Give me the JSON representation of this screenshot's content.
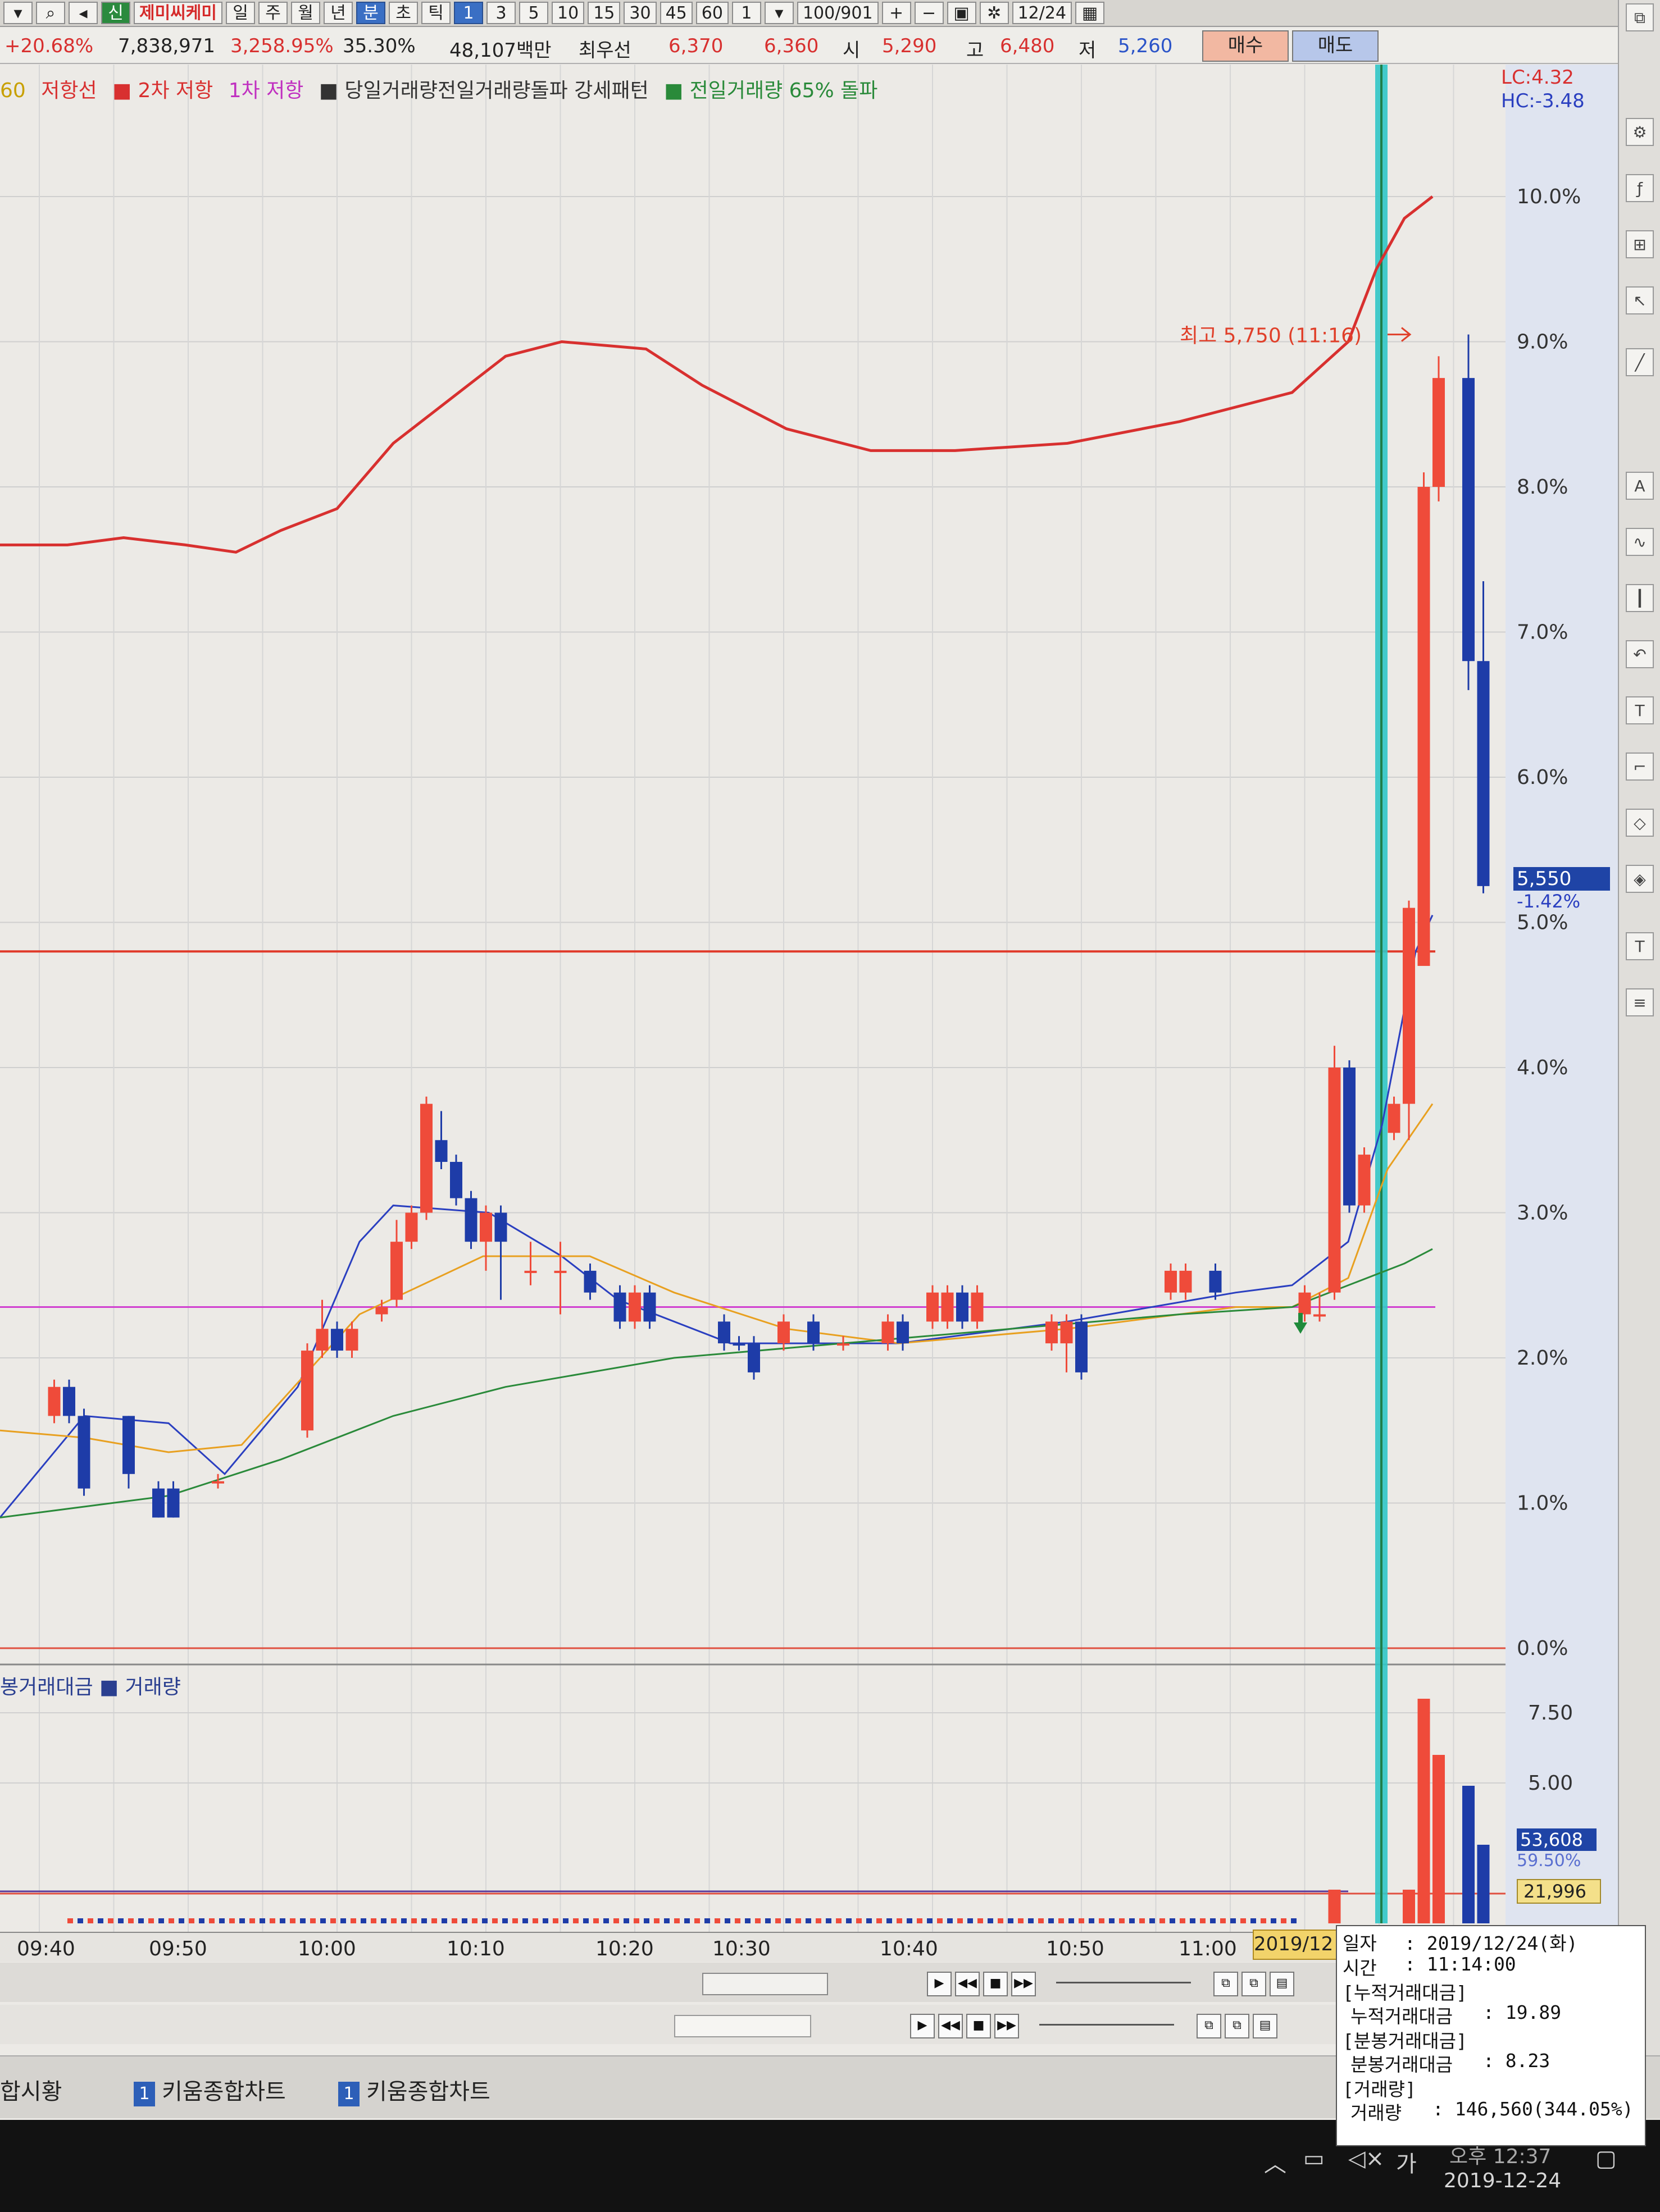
{
  "toolbar": {
    "items": [
      "신",
      "제미씨케미",
      "일",
      "주",
      "월",
      "년",
      "분",
      "초",
      "틱",
      "1",
      "3",
      "5",
      "10",
      "15",
      "30",
      "45",
      "60",
      "1",
      "100/901",
      "12/24"
    ]
  },
  "quote": {
    "change_pct": "+20.68%",
    "volume": "7,838,971",
    "vol_ratio": "3,258.95%",
    "turnover": "35.30%",
    "amount": "48,107백만",
    "best_ask_label": "최우선",
    "ask": "6,370",
    "bid": "6,360",
    "open_label": "시",
    "open": "5,290",
    "high_label": "고",
    "high": "6,480",
    "low_label": "저",
    "low": "5,260",
    "buy_label": "매수",
    "sell_label": "매도"
  },
  "legend": {
    "items": [
      {
        "text": "60",
        "color": "#c8a000"
      },
      {
        "text": "저항선",
        "color": "#d83030"
      },
      {
        "text": "■ 2차 저항",
        "color": "#d83030"
      },
      {
        "text": "1차 저항",
        "color": "#c030c0"
      },
      {
        "text": "■ 당일거래량전일거래량돌파 강세패턴",
        "color": "#333333"
      },
      {
        "text": "■ 전일거래량 65% 돌파",
        "color": "#2a8a3a"
      }
    ]
  },
  "axis_badges": {
    "lc": "LC:4.32",
    "hc": "HC:-3.48",
    "current_price": "5,550",
    "current_pct": "-1.42%",
    "vol_current": "53,608",
    "vol_pct": "59.50%",
    "vol_ma": "21,996"
  },
  "chart_data": {
    "type": "candlestick",
    "title": "제미씨케미 1분",
    "price_axis_ticks": [
      "10.0%",
      "9.0%",
      "8.0%",
      "7.0%",
      "6.0%",
      "5.0%",
      "4.0%",
      "3.0%",
      "2.0%",
      "1.0%",
      "0.0%"
    ],
    "volume_axis_ticks": [
      "7.50",
      "5.00"
    ],
    "time_ticks": [
      "09:40",
      "09:50",
      "10:00",
      "10:10",
      "10:20",
      "10:30",
      "10:40",
      "10:50",
      "11:00",
      "2019/12"
    ],
    "annotation": "최고 5,750 (11:16)",
    "resistance_levels_pct": {
      "horizontal_red": 4.8,
      "magenta": 2.35,
      "zero": 0.0
    },
    "candles": [
      {
        "t": "09:41",
        "o": 1.6,
        "c": 1.8,
        "h": 1.85,
        "l": 1.55,
        "up": true
      },
      {
        "t": "09:42",
        "o": 1.8,
        "c": 1.6,
        "h": 1.85,
        "l": 1.55,
        "up": false
      },
      {
        "t": "09:43",
        "o": 1.6,
        "c": 1.1,
        "h": 1.65,
        "l": 1.05,
        "up": false
      },
      {
        "t": "09:46",
        "o": 1.6,
        "c": 1.2,
        "h": 1.6,
        "l": 1.1,
        "up": false
      },
      {
        "t": "09:48",
        "o": 1.1,
        "c": 0.9,
        "h": 1.15,
        "l": 0.9,
        "up": false
      },
      {
        "t": "09:49",
        "o": 1.1,
        "c": 0.9,
        "h": 1.15,
        "l": 0.9,
        "up": false
      },
      {
        "t": "09:52",
        "o": 1.15,
        "c": 1.15,
        "h": 1.2,
        "l": 1.1,
        "up": true
      },
      {
        "t": "09:58",
        "o": 1.5,
        "c": 2.05,
        "h": 2.1,
        "l": 1.45,
        "up": true
      },
      {
        "t": "09:59",
        "o": 2.05,
        "c": 2.2,
        "h": 2.4,
        "l": 2.0,
        "up": true
      },
      {
        "t": "10:00",
        "o": 2.2,
        "c": 2.05,
        "h": 2.25,
        "l": 2.0,
        "up": false
      },
      {
        "t": "10:01",
        "o": 2.05,
        "c": 2.2,
        "h": 2.25,
        "l": 2.0,
        "up": true
      },
      {
        "t": "10:03",
        "o": 2.3,
        "c": 2.35,
        "h": 2.4,
        "l": 2.25,
        "up": true
      },
      {
        "t": "10:04",
        "o": 2.4,
        "c": 2.8,
        "h": 2.95,
        "l": 2.35,
        "up": true
      },
      {
        "t": "10:05",
        "o": 2.8,
        "c": 3.0,
        "h": 3.05,
        "l": 2.75,
        "up": true
      },
      {
        "t": "10:06",
        "o": 3.0,
        "c": 3.75,
        "h": 3.8,
        "l": 2.95,
        "up": true
      },
      {
        "t": "10:07",
        "o": 3.5,
        "c": 3.35,
        "h": 3.7,
        "l": 3.3,
        "up": false
      },
      {
        "t": "10:08",
        "o": 3.35,
        "c": 3.1,
        "h": 3.4,
        "l": 3.05,
        "up": false
      },
      {
        "t": "10:09",
        "o": 3.1,
        "c": 2.8,
        "h": 3.15,
        "l": 2.75,
        "up": false
      },
      {
        "t": "10:10",
        "o": 2.8,
        "c": 3.0,
        "h": 3.05,
        "l": 2.6,
        "up": true
      },
      {
        "t": "10:11",
        "o": 3.0,
        "c": 2.8,
        "h": 3.05,
        "l": 2.4,
        "up": false
      },
      {
        "t": "10:13",
        "o": 2.6,
        "c": 2.6,
        "h": 2.8,
        "l": 2.5,
        "up": true
      },
      {
        "t": "10:15",
        "o": 2.6,
        "c": 2.6,
        "h": 2.8,
        "l": 2.3,
        "up": true
      },
      {
        "t": "10:17",
        "o": 2.6,
        "c": 2.45,
        "h": 2.65,
        "l": 2.4,
        "up": false
      },
      {
        "t": "10:19",
        "o": 2.45,
        "c": 2.25,
        "h": 2.5,
        "l": 2.2,
        "up": false
      },
      {
        "t": "10:20",
        "o": 2.25,
        "c": 2.45,
        "h": 2.5,
        "l": 2.2,
        "up": true
      },
      {
        "t": "10:21",
        "o": 2.45,
        "c": 2.25,
        "h": 2.5,
        "l": 2.2,
        "up": false
      },
      {
        "t": "10:26",
        "o": 2.25,
        "c": 2.1,
        "h": 2.3,
        "l": 2.05,
        "up": false
      },
      {
        "t": "10:27",
        "o": 2.1,
        "c": 2.1,
        "h": 2.15,
        "l": 2.05,
        "up": false
      },
      {
        "t": "10:28",
        "o": 2.1,
        "c": 1.9,
        "h": 2.15,
        "l": 1.85,
        "up": false
      },
      {
        "t": "10:30",
        "o": 2.1,
        "c": 2.25,
        "h": 2.3,
        "l": 2.05,
        "up": true
      },
      {
        "t": "10:32",
        "o": 2.25,
        "c": 2.1,
        "h": 2.3,
        "l": 2.05,
        "up": false
      },
      {
        "t": "10:34",
        "o": 2.1,
        "c": 2.1,
        "h": 2.15,
        "l": 2.05,
        "up": true
      },
      {
        "t": "10:37",
        "o": 2.1,
        "c": 2.25,
        "h": 2.3,
        "l": 2.05,
        "up": true
      },
      {
        "t": "10:38",
        "o": 2.25,
        "c": 2.1,
        "h": 2.3,
        "l": 2.05,
        "up": false
      },
      {
        "t": "10:40",
        "o": 2.25,
        "c": 2.45,
        "h": 2.5,
        "l": 2.2,
        "up": true
      },
      {
        "t": "10:41",
        "o": 2.25,
        "c": 2.45,
        "h": 2.5,
        "l": 2.2,
        "up": true
      },
      {
        "t": "10:42",
        "o": 2.45,
        "c": 2.25,
        "h": 2.5,
        "l": 2.2,
        "up": false
      },
      {
        "t": "10:43",
        "o": 2.25,
        "c": 2.45,
        "h": 2.5,
        "l": 2.2,
        "up": true
      },
      {
        "t": "10:48",
        "o": 2.1,
        "c": 2.25,
        "h": 2.3,
        "l": 2.05,
        "up": true
      },
      {
        "t": "10:49",
        "o": 2.1,
        "c": 2.25,
        "h": 2.3,
        "l": 1.9,
        "up": true
      },
      {
        "t": "10:50",
        "o": 2.25,
        "c": 1.9,
        "h": 2.3,
        "l": 1.85,
        "up": false
      },
      {
        "t": "10:56",
        "o": 2.45,
        "c": 2.6,
        "h": 2.65,
        "l": 2.4,
        "up": true
      },
      {
        "t": "10:57",
        "o": 2.45,
        "c": 2.6,
        "h": 2.65,
        "l": 2.4,
        "up": true
      },
      {
        "t": "10:59",
        "o": 2.6,
        "c": 2.45,
        "h": 2.65,
        "l": 2.4,
        "up": false
      },
      {
        "t": "11:05",
        "o": 2.3,
        "c": 2.45,
        "h": 2.5,
        "l": 2.25,
        "up": true
      },
      {
        "t": "11:06",
        "o": 2.3,
        "c": 2.3,
        "h": 2.45,
        "l": 2.25,
        "up": true
      },
      {
        "t": "11:07",
        "o": 2.45,
        "c": 4.0,
        "h": 4.15,
        "l": 2.4,
        "up": true
      },
      {
        "t": "11:08",
        "o": 4.0,
        "c": 3.05,
        "h": 4.05,
        "l": 3.0,
        "up": false
      },
      {
        "t": "11:09",
        "o": 3.05,
        "c": 3.4,
        "h": 3.45,
        "l": 3.0,
        "up": true
      },
      {
        "t": "11:11",
        "o": 3.55,
        "c": 3.75,
        "h": 3.8,
        "l": 3.5,
        "up": true
      },
      {
        "t": "11:12",
        "o": 3.75,
        "c": 5.1,
        "h": 5.15,
        "l": 3.5,
        "up": true
      },
      {
        "t": "11:13",
        "o": 4.7,
        "c": 8.0,
        "h": 8.1,
        "l": 4.7,
        "up": true
      },
      {
        "t": "11:14",
        "o": 8.0,
        "c": 8.75,
        "h": 8.9,
        "l": 7.9,
        "up": true
      },
      {
        "t": "11:16",
        "o": 8.75,
        "c": 6.8,
        "h": 9.05,
        "l": 6.6,
        "up": false
      },
      {
        "t": "11:17",
        "o": 6.8,
        "c": 5.25,
        "h": 7.35,
        "l": 5.2,
        "up": false
      }
    ],
    "ma_series": [
      {
        "color": "#2a3fc0",
        "points": [
          [
            0,
            0.9
          ],
          [
            150,
            1.6
          ],
          [
            300,
            1.55
          ],
          [
            400,
            1.2
          ],
          [
            530,
            1.8
          ],
          [
            640,
            2.8
          ],
          [
            700,
            3.05
          ],
          [
            870,
            3.0
          ],
          [
            1000,
            2.7
          ],
          [
            1100,
            2.4
          ],
          [
            1300,
            2.1
          ],
          [
            1600,
            2.1
          ],
          [
            1900,
            2.25
          ],
          [
            2200,
            2.45
          ],
          [
            2300,
            2.5
          ],
          [
            2400,
            2.8
          ],
          [
            2460,
            3.6
          ],
          [
            2520,
            4.8
          ],
          [
            2550,
            5.05
          ]
        ]
      },
      {
        "color": "#e8a020",
        "points": [
          [
            0,
            1.5
          ],
          [
            150,
            1.45
          ],
          [
            300,
            1.35
          ],
          [
            430,
            1.4
          ],
          [
            640,
            2.3
          ],
          [
            860,
            2.7
          ],
          [
            1050,
            2.7
          ],
          [
            1200,
            2.45
          ],
          [
            1400,
            2.2
          ],
          [
            1600,
            2.1
          ],
          [
            1900,
            2.2
          ],
          [
            2200,
            2.35
          ],
          [
            2300,
            2.35
          ],
          [
            2400,
            2.55
          ],
          [
            2470,
            3.3
          ],
          [
            2550,
            3.75
          ]
        ]
      },
      {
        "color": "#2a8a3a",
        "points": [
          [
            0,
            0.9
          ],
          [
            300,
            1.05
          ],
          [
            500,
            1.3
          ],
          [
            700,
            1.6
          ],
          [
            900,
            1.8
          ],
          [
            1200,
            2.0
          ],
          [
            1500,
            2.1
          ],
          [
            1800,
            2.2
          ],
          [
            2100,
            2.3
          ],
          [
            2300,
            2.35
          ],
          [
            2400,
            2.5
          ],
          [
            2500,
            2.65
          ],
          [
            2550,
            2.75
          ]
        ]
      },
      {
        "color": "#d8302f",
        "points": [
          [
            0,
            7.6
          ],
          [
            120,
            7.6
          ],
          [
            220,
            7.65
          ],
          [
            330,
            7.6
          ],
          [
            420,
            7.55
          ],
          [
            500,
            7.7
          ],
          [
            600,
            7.85
          ],
          [
            700,
            8.3
          ],
          [
            800,
            8.6
          ],
          [
            900,
            8.9
          ],
          [
            1000,
            9.0
          ],
          [
            1150,
            8.95
          ],
          [
            1250,
            8.7
          ],
          [
            1400,
            8.4
          ],
          [
            1550,
            8.25
          ],
          [
            1700,
            8.25
          ],
          [
            1900,
            8.3
          ],
          [
            2100,
            8.45
          ],
          [
            2300,
            8.65
          ],
          [
            2400,
            9.0
          ],
          [
            2450,
            9.5
          ],
          [
            2500,
            9.85
          ],
          [
            2550,
            10.0
          ]
        ]
      }
    ],
    "volume_bars": [
      {
        "t": "11:07",
        "v": 1.2,
        "up": true
      },
      {
        "t": "11:12",
        "v": 1.2,
        "up": true
      },
      {
        "t": "11:13",
        "v": 8.0,
        "up": true
      },
      {
        "t": "11:14",
        "v": 6.0,
        "up": true
      },
      {
        "t": "11:16",
        "v": 4.9,
        "up": false
      },
      {
        "t": "11:17",
        "v": 2.8,
        "up": false
      }
    ]
  },
  "tooltip": {
    "date_label": "일자",
    "date_value": ": 2019/12/24(화)",
    "time_label": "시간",
    "time_value": ": 11:14:00",
    "cum_header": "[누적거래대금]",
    "cum_label": "누적거래대금",
    "cum_value": ": 19.89",
    "min_header": "[분봉거래대금]",
    "min_label": "분봉거래대금",
    "min_value": ": 8.23",
    "vol_header": "[거래량]",
    "vol_label": "거래량",
    "vol_value": ": 146,560(344.05%)"
  },
  "volume_legend": "봉거래대금 ■ 거래량",
  "date_tag": "2019/12",
  "tabs": [
    {
      "num": "",
      "label": "합시황"
    },
    {
      "num": "1",
      "label": "키움종합차트"
    },
    {
      "num": "1",
      "label": "키움종합차트"
    }
  ],
  "taskbar": {
    "time": "오후 12:37",
    "date": "2019-12-24",
    "ime": "가",
    "speaker": "◁×"
  }
}
